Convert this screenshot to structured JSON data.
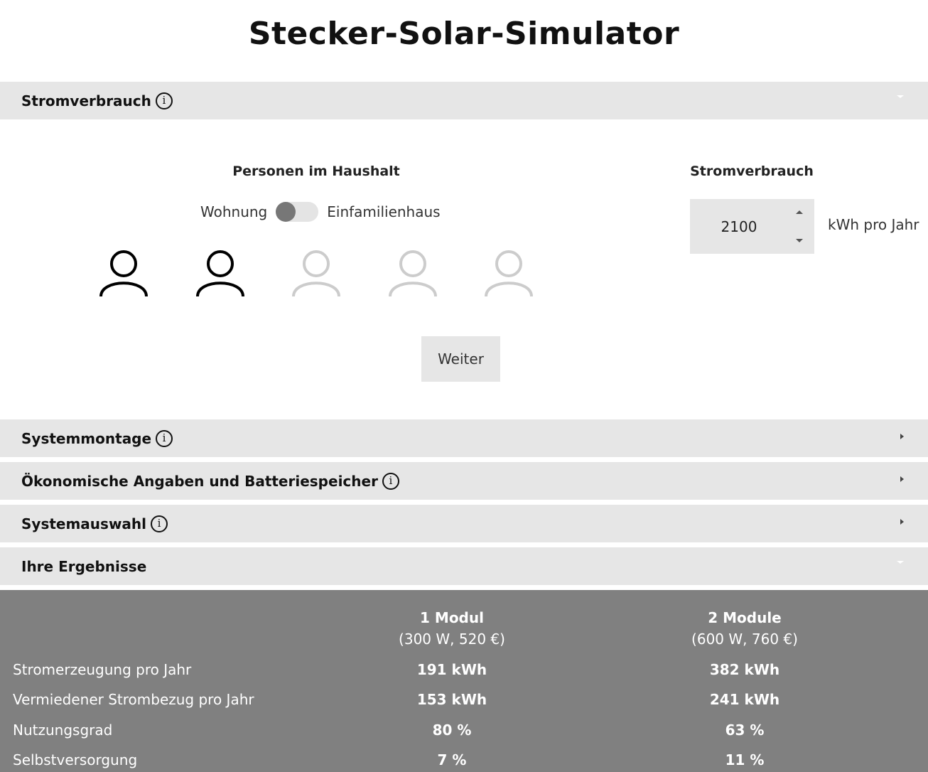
{
  "title": "Stecker-Solar-Simulator",
  "sections": {
    "stromverbrauch": "Stromverbrauch",
    "systemmontage": "Systemmontage",
    "oekonomisch": "Ökonomische Angaben und Batteriespeicher",
    "systemauswahl": "Systemauswahl",
    "ergebnisse": "Ihre Ergebnisse"
  },
  "info_icon_glyph": "i",
  "household": {
    "title": "Personen im Haushalt",
    "toggle_left": "Wohnung",
    "toggle_right": "Einfamilienhaus",
    "persons_total": 5,
    "persons_selected": 2
  },
  "consumption": {
    "title": "Stromverbrauch",
    "value": "2100",
    "unit": "kWh pro Jahr"
  },
  "next_button": "Weiter",
  "results": {
    "columns": [
      {
        "name": "1 Modul",
        "detail": "(300 W, 520 €)"
      },
      {
        "name": "2 Module",
        "detail": "(600 W, 760 €)"
      }
    ],
    "rows": [
      {
        "label": "Stromerzeugung pro Jahr",
        "values": [
          "191 kWh",
          "382 kWh"
        ]
      },
      {
        "label": "Vermiedener Strombezug pro Jahr",
        "values": [
          "153 kWh",
          "241 kWh"
        ]
      },
      {
        "label": "Nutzungsgrad",
        "values": [
          "80 %",
          "63 %"
        ]
      },
      {
        "label": "Selbstversorgung",
        "values": [
          "7 %",
          "11 %"
        ]
      }
    ]
  },
  "colors": {
    "section_bg": "#e6e6e6",
    "results_bg": "#808080",
    "person_active": "#000000",
    "person_inactive": "#cccccc",
    "toggle_knob": "#777777"
  }
}
